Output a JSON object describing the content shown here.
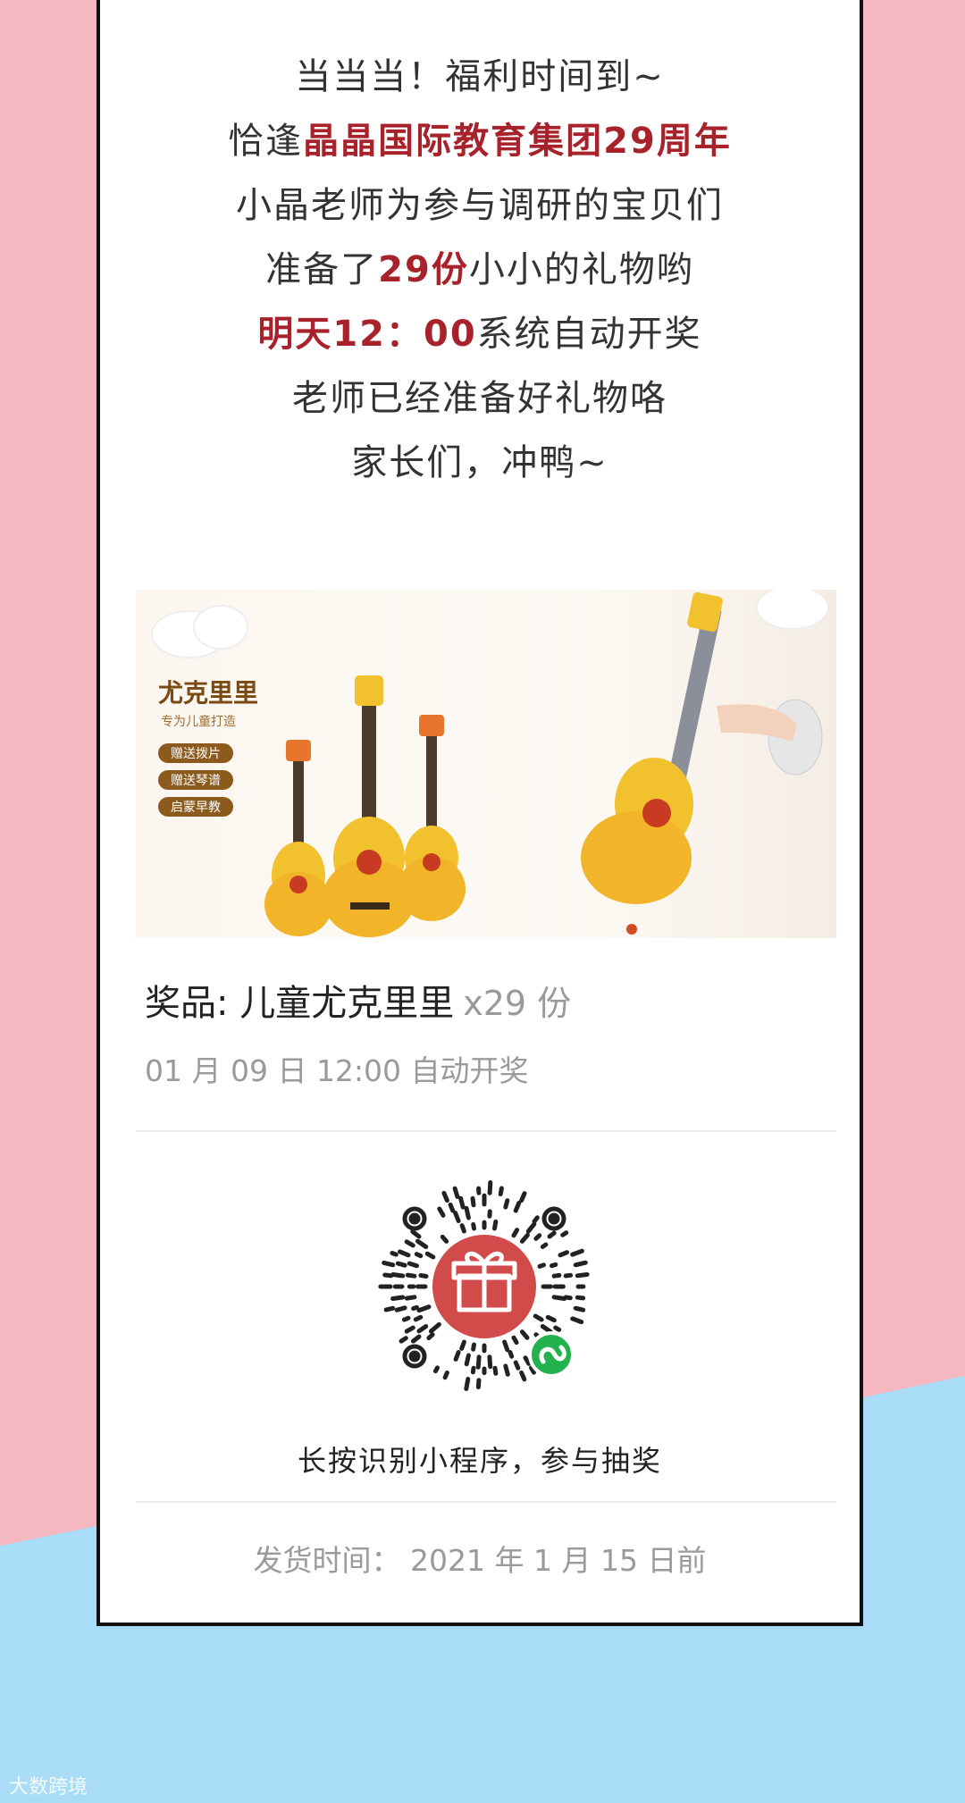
{
  "intro": {
    "line1": "当当当！福利时间到~",
    "line2_pre": "恰逢",
    "line2_hl": "晶晶国际教育集团29周年",
    "line3": "小晶老师为参与调研的宝贝们",
    "line4_pre": "准备了",
    "line4_hl": "29份",
    "line4_post": "小小的礼物哟",
    "line5_hl": "明天12：00",
    "line5_post": "系统自动开奖",
    "line6": "老师已经准备好礼物咯",
    "line7": "家长们，冲鸭~"
  },
  "product": {
    "title": "尤克里里",
    "subtitle": "专为儿童打造",
    "tags": [
      "赠送拨片",
      "赠送琴谱",
      "启蒙早教"
    ]
  },
  "prize": {
    "label": "奖品: 儿童尤克里里",
    "quantity": "x29 份",
    "draw_time": "01 月 09 日 12:00 自动开奖"
  },
  "qr": {
    "caption": "长按识别小程序，参与抽奖"
  },
  "shipping": {
    "text": "发货时间：  2021 年 1 月 15 日前"
  },
  "watermark": {
    "text": "大数跨境"
  },
  "colors": {
    "accent_red": "#a8222c",
    "background_pink": "#f5b8c0",
    "background_blue": "#a9dcf7",
    "gift_red": "#d24b4b",
    "miniprogram_green": "#22b14c"
  }
}
